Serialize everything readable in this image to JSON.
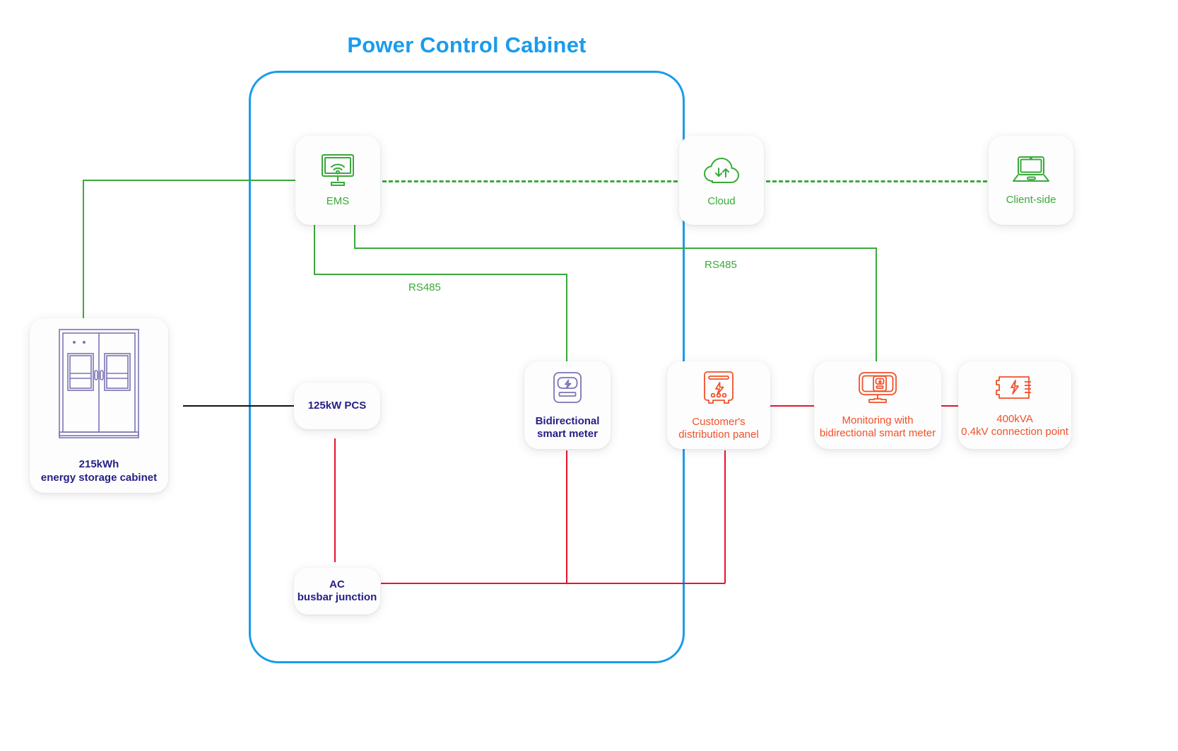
{
  "diagram": {
    "title": "Power Control Cabinet",
    "title_color": "#1a9ceb",
    "colors": {
      "cabinet_border": "#1a9ceb",
      "comm_line": "#3aa93a",
      "power_line": "#e8132b",
      "dc_line": "#111111",
      "navy_text": "#241f86",
      "orange_text": "#f0502a",
      "green_text": "#3aa93a",
      "purple_icon": "#7b76b5"
    }
  },
  "nodes": {
    "ems": {
      "label": "EMS",
      "icon": "monitor-wifi-icon",
      "color": "green"
    },
    "cloud": {
      "label": "Cloud",
      "icon": "cloud-sync-icon",
      "color": "green"
    },
    "client": {
      "label": "Client-side",
      "icon": "laptop-icon",
      "color": "green"
    },
    "ess": {
      "label": "215kWh\nenergy storage cabinet",
      "icon": "storage-cabinet-icon",
      "color": "navy"
    },
    "pcs": {
      "label": "125kW PCS",
      "icon": "none",
      "color": "navy"
    },
    "bsm": {
      "label": "Bidirectional\nsmart meter",
      "icon": "smart-meter-icon",
      "color": "navy"
    },
    "cdp": {
      "label": "Customer's\ndistribution panel",
      "icon": "distribution-panel-icon",
      "color": "orange"
    },
    "mon": {
      "label": "Monitoring with\nbidirectional smart meter",
      "icon": "monitor-meter-icon",
      "color": "orange"
    },
    "conn": {
      "label": "400kVA\n0.4kV connection point",
      "icon": "transformer-icon",
      "color": "orange"
    },
    "ac": {
      "label": "AC\nbusbar junction",
      "icon": "none",
      "color": "navy"
    }
  },
  "link_labels": {
    "rs485_left": "RS485",
    "rs485_right": "RS485"
  }
}
